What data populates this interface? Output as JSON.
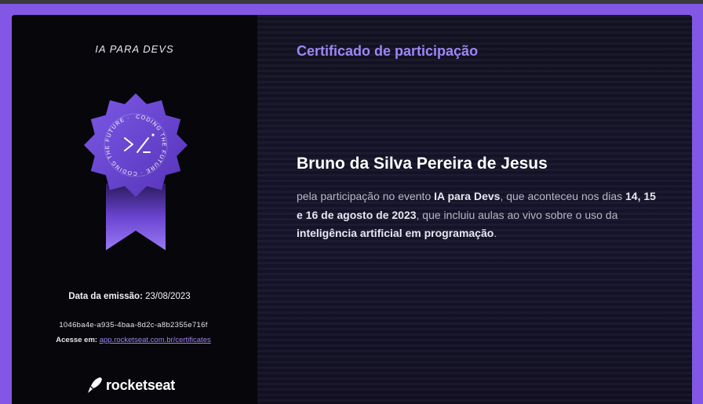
{
  "event_logo": {
    "text": "IA PARA DEVS"
  },
  "badge": {
    "ring_text": "CODING THE FUTURE · CODING THE FUTURE ·"
  },
  "issue": {
    "label": "Data da emissão:",
    "date": "23/08/2023"
  },
  "certificate_code": "1046ba4e-a935-4baa-8d2c-a8b2355e716f",
  "access": {
    "label": "Acesse em:",
    "link_text": "app.rocketseat.com.br/certificates"
  },
  "brand": {
    "name": "rocketseat"
  },
  "certificate": {
    "title": "Certificado de participação",
    "recipient": "Bruno da Silva Pereira de Jesus",
    "text_1": "pela participação no evento ",
    "event_name": "IA para Devs",
    "text_2": ", que aconteceu nos dias ",
    "dates": "14, 15 e 16 de agosto de 2023",
    "text_3": ", que incluiu aulas ao vivo sobre o uso da ",
    "topic": "inteligência artificial em programação",
    "text_4": "."
  },
  "colors": {
    "accent": "#8257e5",
    "title": "#9f86f5",
    "link": "#9d86f0"
  }
}
